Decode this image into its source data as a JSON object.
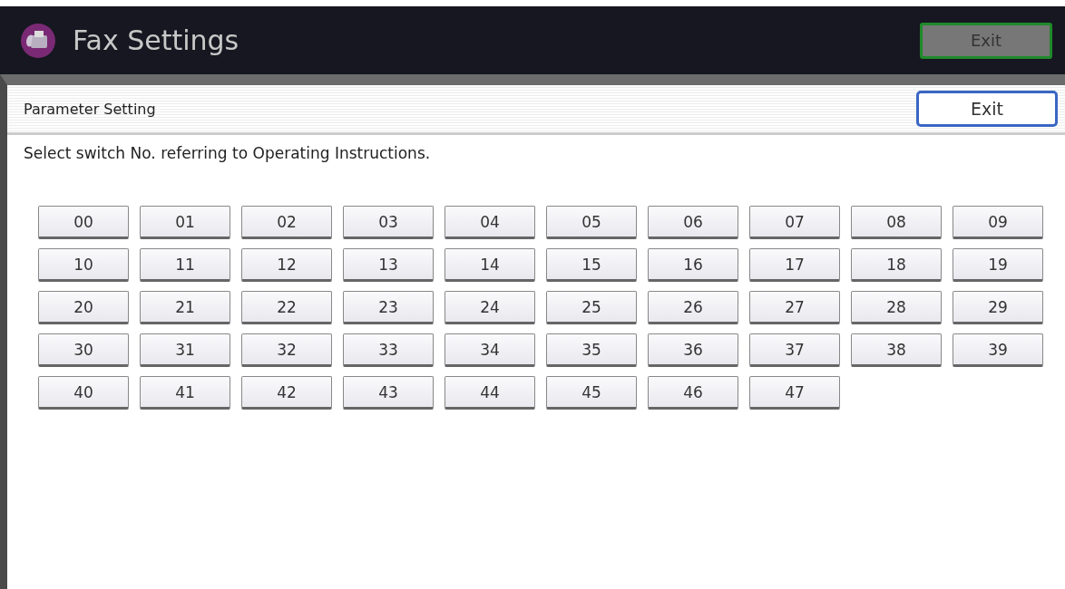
{
  "header": {
    "title": "Fax Settings",
    "exit_button": "Exit"
  },
  "panel": {
    "title": "Parameter Setting",
    "exit_button": "Exit",
    "instruction": "Select switch No. referring to Operating Instructions."
  },
  "switches": [
    "00",
    "01",
    "02",
    "03",
    "04",
    "05",
    "06",
    "07",
    "08",
    "09",
    "10",
    "11",
    "12",
    "13",
    "14",
    "15",
    "16",
    "17",
    "18",
    "19",
    "20",
    "21",
    "22",
    "23",
    "24",
    "25",
    "26",
    "27",
    "28",
    "29",
    "30",
    "31",
    "32",
    "33",
    "34",
    "35",
    "36",
    "37",
    "38",
    "39",
    "40",
    "41",
    "42",
    "43",
    "44",
    "45",
    "46",
    "47"
  ]
}
